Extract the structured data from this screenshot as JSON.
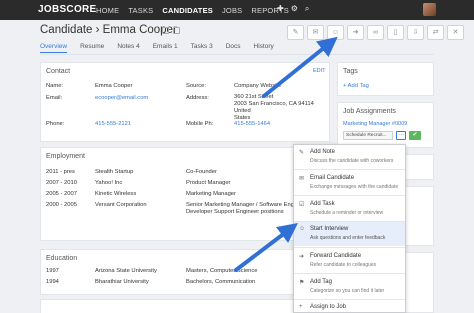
{
  "nav": {
    "logo": "JOBSCORE",
    "links": [
      "HOME",
      "TASKS",
      "CANDIDATES",
      "JOBS",
      "REPORTS"
    ],
    "active": "CANDIDATES",
    "icons": [
      "plus-icon",
      "gear-icon",
      "search-icon"
    ]
  },
  "header": {
    "title": "Candidate › Emma Cooper",
    "tabs": [
      "Overview",
      "Resume",
      "Notes 4",
      "Emails 1",
      "Tasks 3",
      "Docs",
      "History"
    ],
    "action_icons": [
      "reply-icon",
      "email-icon",
      "interview-icon",
      "forward-icon",
      "link-icon",
      "trash-icon",
      "download-icon",
      "move-icon",
      "close-icon"
    ]
  },
  "contact": {
    "title": "Contact",
    "edit": "EDIT",
    "name_label": "Name:",
    "name": "Emma Cooper",
    "email_label": "Email:",
    "email": "ecooper@email.com",
    "phone_label": "Phone:",
    "phone": "415-555-2121",
    "source_label": "Source:",
    "source": "Company Website",
    "address_label": "Address:",
    "address": [
      "360 21st Street",
      "2003 San Francisco, CA 94114",
      "United",
      "States"
    ],
    "mobile_label": "Mobile Ph:",
    "mobile": "415-555-1464"
  },
  "employment": {
    "title": "Employment",
    "rows": [
      {
        "years": "2011 - pres",
        "company": "Stealth Startup",
        "role": "Co-Founder"
      },
      {
        "years": "2007 - 2010",
        "company": "Yahoo! Inc",
        "role": "Product Manager"
      },
      {
        "years": "2005 - 2007",
        "company": "Kinetic Wireless",
        "role": "Marketing Manager"
      },
      {
        "years": "2000 - 2005",
        "company": "Versant Corporation",
        "role": "Senior Marketing Manager / Software Engineer,"
      },
      {
        "years": "",
        "company": "",
        "role": "Developer Support Engineer positions"
      }
    ]
  },
  "education": {
    "title": "Education",
    "rows": [
      {
        "years": "1997",
        "school": "Arizona State University",
        "degree": "Masters, Computer Science"
      },
      {
        "years": "1994",
        "school": "Bharathiar University",
        "degree": "Bachelors, Communication"
      }
    ]
  },
  "tags": {
    "title": "Tags",
    "add": "+ Add Tag"
  },
  "assignments": {
    "title": "Job Assignments",
    "job": "Marketing Manager #0009",
    "stage": "Schedule Recruit...",
    "more": "..."
  },
  "menu": [
    {
      "icon": "note-icon",
      "glyph": "✎",
      "title": "Add Note",
      "sub": "Discuss the candidate with coworkers"
    },
    {
      "icon": "email-icon",
      "glyph": "✉",
      "title": "Email Candidate",
      "sub": "Exchange messages with the candidate"
    },
    {
      "icon": "task-icon",
      "glyph": "☑",
      "title": "Add Task",
      "sub": "Schedule a reminder or interview"
    },
    {
      "icon": "interview-icon",
      "glyph": "☺",
      "title": "Start Interview",
      "sub": "Ask questions and enter feedback"
    },
    {
      "icon": "forward-icon",
      "glyph": "➜",
      "title": "Forward Candidate",
      "sub": "Refer candidate to colleagues"
    },
    {
      "icon": "tag-icon",
      "glyph": "⚑",
      "title": "Add Tag",
      "sub": "Categorize so you can find it later"
    },
    {
      "icon": "assign-icon",
      "glyph": "+",
      "title": "Assign to Job",
      "sub": ""
    }
  ],
  "colors": {
    "accent": "#3a7bd5",
    "arrow": "#2f6fd6",
    "nav_bg": "#2b2b2b",
    "highlight": "#e6eefb",
    "thumbs": "#5cb85c"
  }
}
